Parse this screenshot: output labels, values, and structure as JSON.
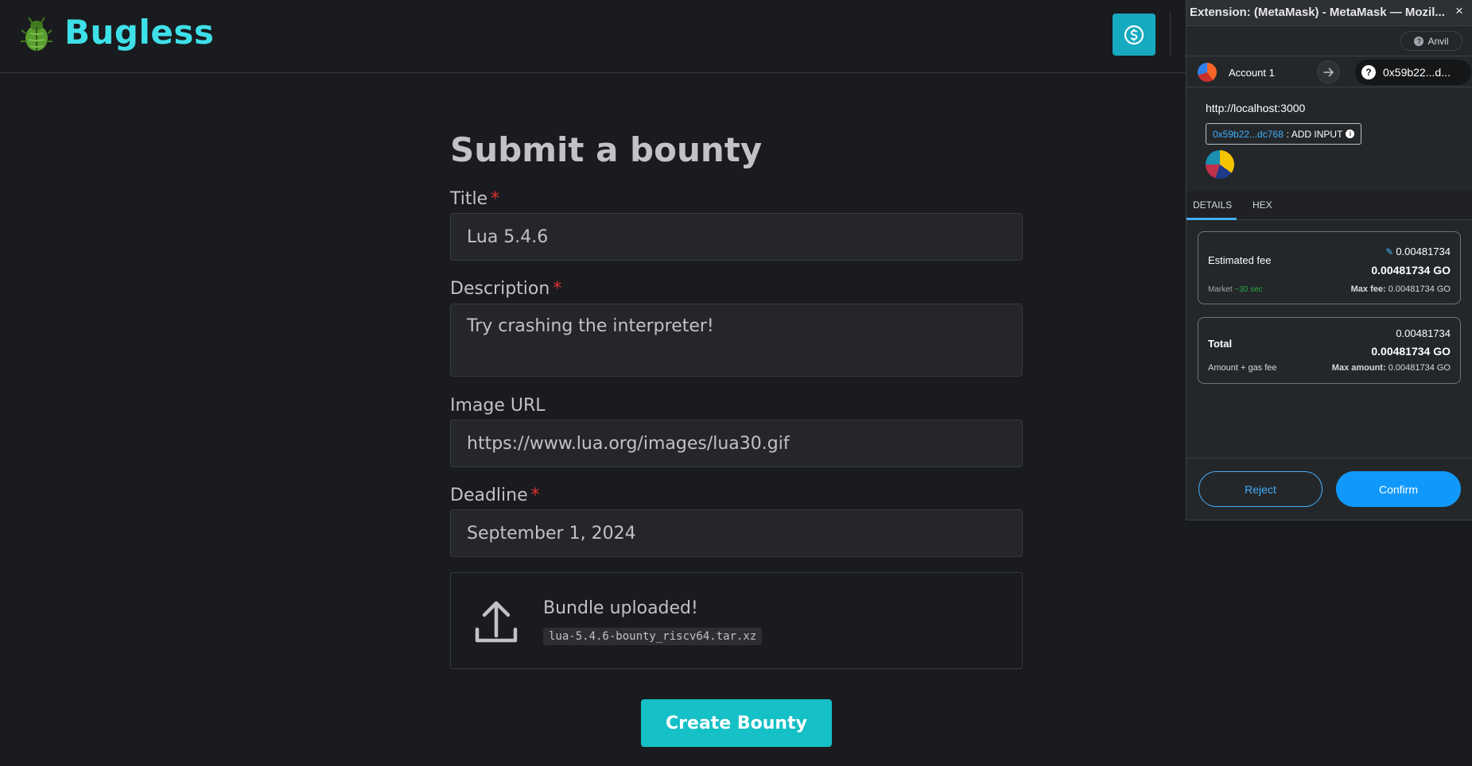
{
  "app": {
    "logo_text": "Bugless",
    "logo_icon": "beetle-icon",
    "bounty_icon": "dollar-circle-icon",
    "accent": "#15aabf"
  },
  "form": {
    "title": "Submit a bounty",
    "title_label": "Title",
    "title_value": "Lua 5.4.6",
    "description_label": "Description",
    "description_value": "Try crashing the interpreter!",
    "image_url_label": "Image URL",
    "image_url_value": "https://www.lua.org/images/lua30.gif",
    "deadline_label": "Deadline",
    "deadline_value": "September 1, 2024",
    "required_mark": "*",
    "upload_icon": "upload-icon",
    "upload_status": "Bundle uploaded!",
    "upload_filename": "lua-5.4.6-bounty_riscv64.tar.xz",
    "submit_label": "Create Bounty"
  },
  "metamask": {
    "window_title": "Extension: (MetaMask) - MetaMask — Mozil...",
    "close": "×",
    "network": "Anvil",
    "network_icon": "?",
    "account": "Account 1",
    "to_address": "0x59b22...d...",
    "to_icon": "?",
    "origin": "http://localhost:3000",
    "contract_address": "0x59b22...dc768",
    "add_input": ": ADD INPUT",
    "info_icon": "i",
    "tabs": [
      "DETAILS",
      "HEX"
    ],
    "fee": {
      "label": "Estimated fee",
      "value": "0.00481734",
      "value_go": "0.00481734 GO",
      "market": "Market",
      "market_time": "~30 sec",
      "max_fee_label": "Max fee:",
      "max_fee": "0.00481734 GO"
    },
    "total": {
      "label": "Total",
      "value": "0.00481734",
      "value_go": "0.00481734 GO",
      "sub_label": "Amount + gas fee",
      "max_amount_label": "Max amount:",
      "max_amount": "0.00481734 GO"
    },
    "reject_label": "Reject",
    "confirm_label": "Confirm",
    "primary_color": "#1098fc"
  }
}
